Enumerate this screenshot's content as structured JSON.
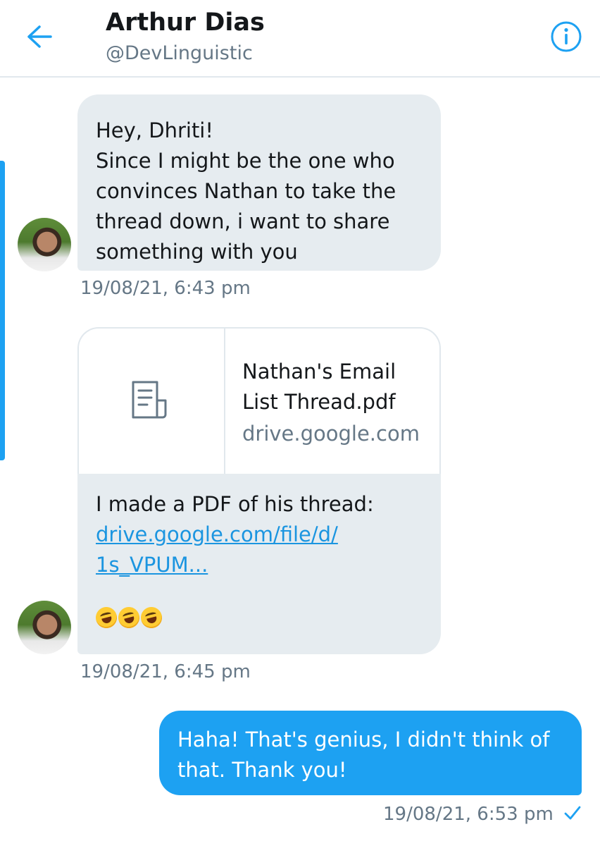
{
  "header": {
    "name": "Arthur Dias",
    "handle": "@DevLinguistic",
    "back_icon": "arrow-left-icon",
    "info_icon": "info-icon",
    "accent_color": "#1da1f2"
  },
  "messages": [
    {
      "direction": "received",
      "text": "Hey, Dhriti!\nSince I might be the one who convinces Nathan to take the thread down, i want to share something with you",
      "time": "19/08/21, 6:43 pm"
    },
    {
      "direction": "received",
      "card": {
        "icon": "document-icon",
        "title": "Nathan's Email List Thread.pdf",
        "domain": "drive.google.com"
      },
      "text": "I made a PDF of his thread:",
      "link_line1": "drive.google.com/file/d/",
      "link_line2": "1s_VPUM...",
      "emojis": [
        "rolling-on-floor-laughing-emoji",
        "rolling-on-floor-laughing-emoji",
        "rolling-on-floor-laughing-emoji"
      ],
      "time": "19/08/21, 6:45 pm"
    },
    {
      "direction": "sent",
      "text": "Haha! That's genius, I didn't think of that. Thank you!",
      "time": "19/08/21, 6:53 pm",
      "status_icon": "checkmark-icon"
    }
  ],
  "colors": {
    "received_bubble": "#e6ecf0",
    "sent_bubble": "#1da1f2",
    "timestamp": "#657786",
    "link": "#1b95e0"
  }
}
